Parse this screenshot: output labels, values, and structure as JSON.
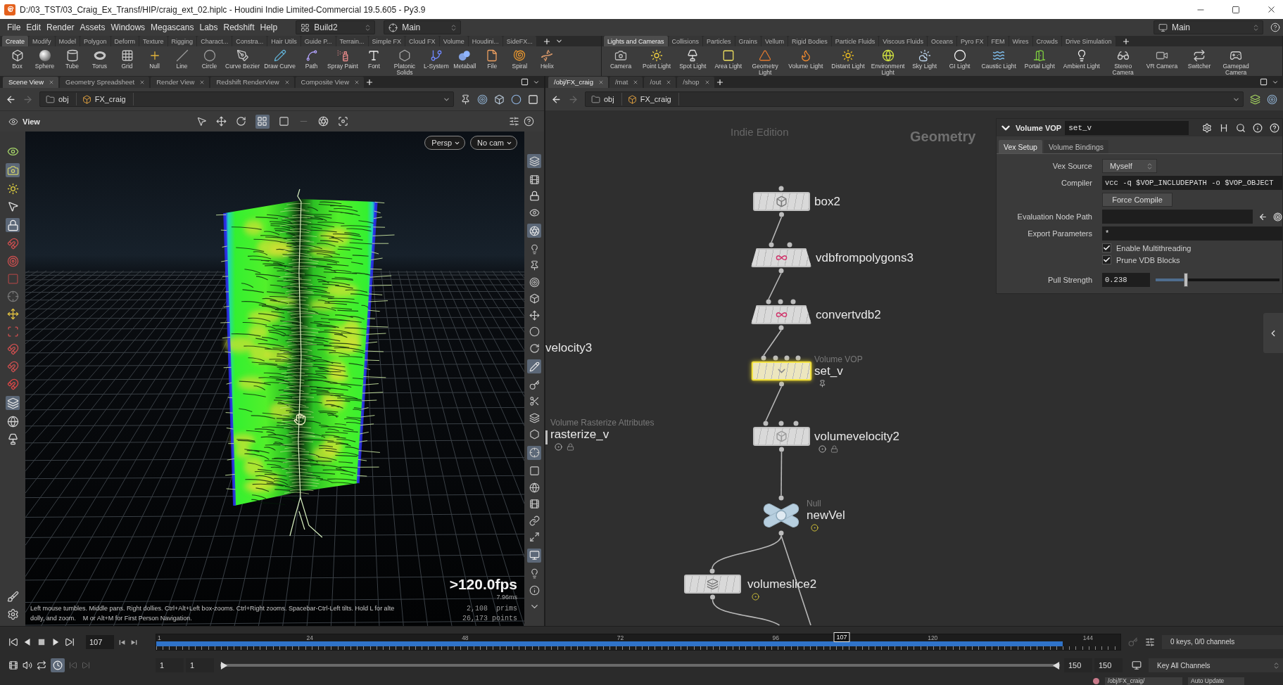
{
  "window": {
    "title": "D:/03_TST/03_Craig_Ex_Transf/HIP/craig_ext_02.hiplc - Houdini Indie Limited-Commercial 19.5.605 - Py3.9"
  },
  "menu_bar": {
    "items": [
      "File",
      "Edit",
      "Render",
      "Assets",
      "Windows",
      "Megascans",
      "Labs",
      "Redshift",
      "Help"
    ],
    "desktop": "Build2",
    "context": "Main",
    "right_context": "Main"
  },
  "shelves": [
    {
      "tabs": [
        {
          "label": "Create",
          "selected": true
        },
        {
          "label": "Modify",
          "selected": false
        },
        {
          "label": "Model",
          "selected": false
        },
        {
          "label": "Polygon",
          "selected": false
        },
        {
          "label": "Deform",
          "selected": false
        },
        {
          "label": "Texture",
          "selected": false
        },
        {
          "label": "Rigging",
          "selected": false
        },
        {
          "label": "Charact...",
          "selected": false
        },
        {
          "label": "Constra...",
          "selected": false
        },
        {
          "label": "Hair Utils",
          "selected": false
        },
        {
          "label": "Guide P...",
          "selected": false
        },
        {
          "label": "Terrain...",
          "selected": false
        },
        {
          "label": "Simple FX",
          "selected": false
        },
        {
          "label": "Cloud FX",
          "selected": false
        },
        {
          "label": "Volume",
          "selected": false
        },
        {
          "label": "Houdini...",
          "selected": false
        },
        {
          "label": "SideFX...",
          "selected": false
        }
      ],
      "tools": [
        "Box",
        "Sphere",
        "Tube",
        "Torus",
        "Grid",
        "Null",
        "Line",
        "Circle",
        "Curve Bezier",
        "Draw Curve",
        "Path",
        "Spray Paint",
        "Font",
        "Platonic Solids",
        "L-System",
        "Metaball",
        "File",
        "Spiral",
        "Helix"
      ]
    },
    {
      "tabs": [
        {
          "label": "Lights and Cameras",
          "selected": true
        },
        {
          "label": "Collisions",
          "selected": false
        },
        {
          "label": "Particles",
          "selected": false
        },
        {
          "label": "Grains",
          "selected": false
        },
        {
          "label": "Vellum",
          "selected": false
        },
        {
          "label": "Rigid Bodies",
          "selected": false
        },
        {
          "label": "Particle Fluids",
          "selected": false
        },
        {
          "label": "Viscous Fluids",
          "selected": false
        },
        {
          "label": "Oceans",
          "selected": false
        },
        {
          "label": "Pyro FX",
          "selected": false
        },
        {
          "label": "FEM",
          "selected": false
        },
        {
          "label": "Wires",
          "selected": false
        },
        {
          "label": "Crowds",
          "selected": false
        },
        {
          "label": "Drive Simulation",
          "selected": false
        }
      ],
      "tools": [
        "Camera",
        "Point Light",
        "Spot Light",
        "Area Light",
        "Geometry Light",
        "Volume Light",
        "Distant Light",
        "Environment Light",
        "Sky Light",
        "GI Light",
        "Caustic Light",
        "Portal Light",
        "Ambient Light",
        "Stereo Camera",
        "VR Camera",
        "Switcher",
        "Gamepad Camera"
      ]
    }
  ],
  "scene_pane": {
    "tabs": [
      {
        "label": "Scene View",
        "selected": true
      },
      {
        "label": "Geometry Spreadsheet",
        "selected": false
      },
      {
        "label": "Render View",
        "selected": false
      },
      {
        "label": "Redshift RenderView",
        "selected": false
      },
      {
        "label": "Composite View",
        "selected": false
      }
    ],
    "path": [
      "obj",
      "FX_craig"
    ],
    "viewport": {
      "title": "View",
      "camera_menus": [
        "Persp",
        "No cam"
      ],
      "fps": ">120.0fps",
      "frame_time": "7.96ms",
      "stats": [
        "2,108  prims",
        "26,173 points"
      ],
      "help": [
        "Left mouse tumbles. Middle pans. Right dollies. Ctrl+Alt+Left box-zooms. Ctrl+Right zooms. Spacebar-Ctrl-Left tilts. Hold L for alte",
        "dolly, and zoom.    M or Alt+M for First Person Navigation."
      ]
    }
  },
  "network_pane": {
    "tabs": [
      {
        "label": "/obj/FX_craig",
        "selected": true
      },
      {
        "label": "/mat",
        "selected": false
      },
      {
        "label": "/out",
        "selected": false
      },
      {
        "label": "/shop",
        "selected": false
      }
    ],
    "path": [
      "obj",
      "FX_craig"
    ],
    "edition": "Indie Edition",
    "context": "Geometry",
    "nodes": [
      {
        "name": "box2",
        "kind": "box",
        "selected": false
      },
      {
        "name": "vdbfrompolygons3",
        "kind": "trapezoid",
        "selected": false
      },
      {
        "name": "convertvdb2",
        "kind": "trapezoid",
        "selected": false
      },
      {
        "name": "velocity3",
        "kind": "offscreen",
        "selected": false
      },
      {
        "name": "set_v",
        "type": "Volume VOP",
        "kind": "box",
        "selected": true
      },
      {
        "name": "rasterize_v",
        "type": "Volume Rasterize Attributes",
        "kind": "offscreen",
        "selected": false
      },
      {
        "name": "volumevelocity2",
        "kind": "box",
        "selected": false
      },
      {
        "name": "newVel",
        "type": "Null",
        "kind": "null",
        "selected": false
      },
      {
        "name": "volumeslice2",
        "kind": "box",
        "selected": false
      }
    ]
  },
  "parameters": {
    "node_type": "Volume VOP",
    "node_name": "set_v",
    "tabs": [
      {
        "label": "Vex Setup",
        "selected": true
      },
      {
        "label": "Volume Bindings",
        "selected": false
      }
    ],
    "rows": [
      {
        "kind": "menu",
        "label": "Vex Source",
        "value": "Myself"
      },
      {
        "kind": "text",
        "label": "Compiler",
        "value": "vcc -q $VOP_INCLUDEPATH -o $VOP_OBJECT"
      },
      {
        "kind": "button",
        "label": "Force Compile"
      },
      {
        "kind": "path",
        "label": "Evaluation Node Path"
      },
      {
        "kind": "text",
        "label": "Export Parameters",
        "value": "*"
      },
      {
        "kind": "checkbox",
        "label": "Enable Multithreading",
        "checked": true
      },
      {
        "kind": "checkbox",
        "label": "Prune VDB Blocks",
        "checked": true
      },
      {
        "kind": "slider",
        "label": "Pull Strength",
        "value": "0.238",
        "level": 0.238
      }
    ]
  },
  "timeline": {
    "frame": "107",
    "ticks": [
      "1",
      "24",
      "48",
      "72",
      "96",
      "120",
      "144"
    ],
    "playhead": {
      "label": "107",
      "level": 0.711
    },
    "cache": {
      "level": 0.94
    },
    "start_fields": [
      "1",
      "1"
    ],
    "end_fields": [
      "150",
      "150"
    ],
    "keys_info": "0 keys, 0/0 channels",
    "key_button": "Key All Channels"
  },
  "status_bar": {
    "path": "/obj/FX_craig/",
    "update_mode": "Auto Update"
  }
}
